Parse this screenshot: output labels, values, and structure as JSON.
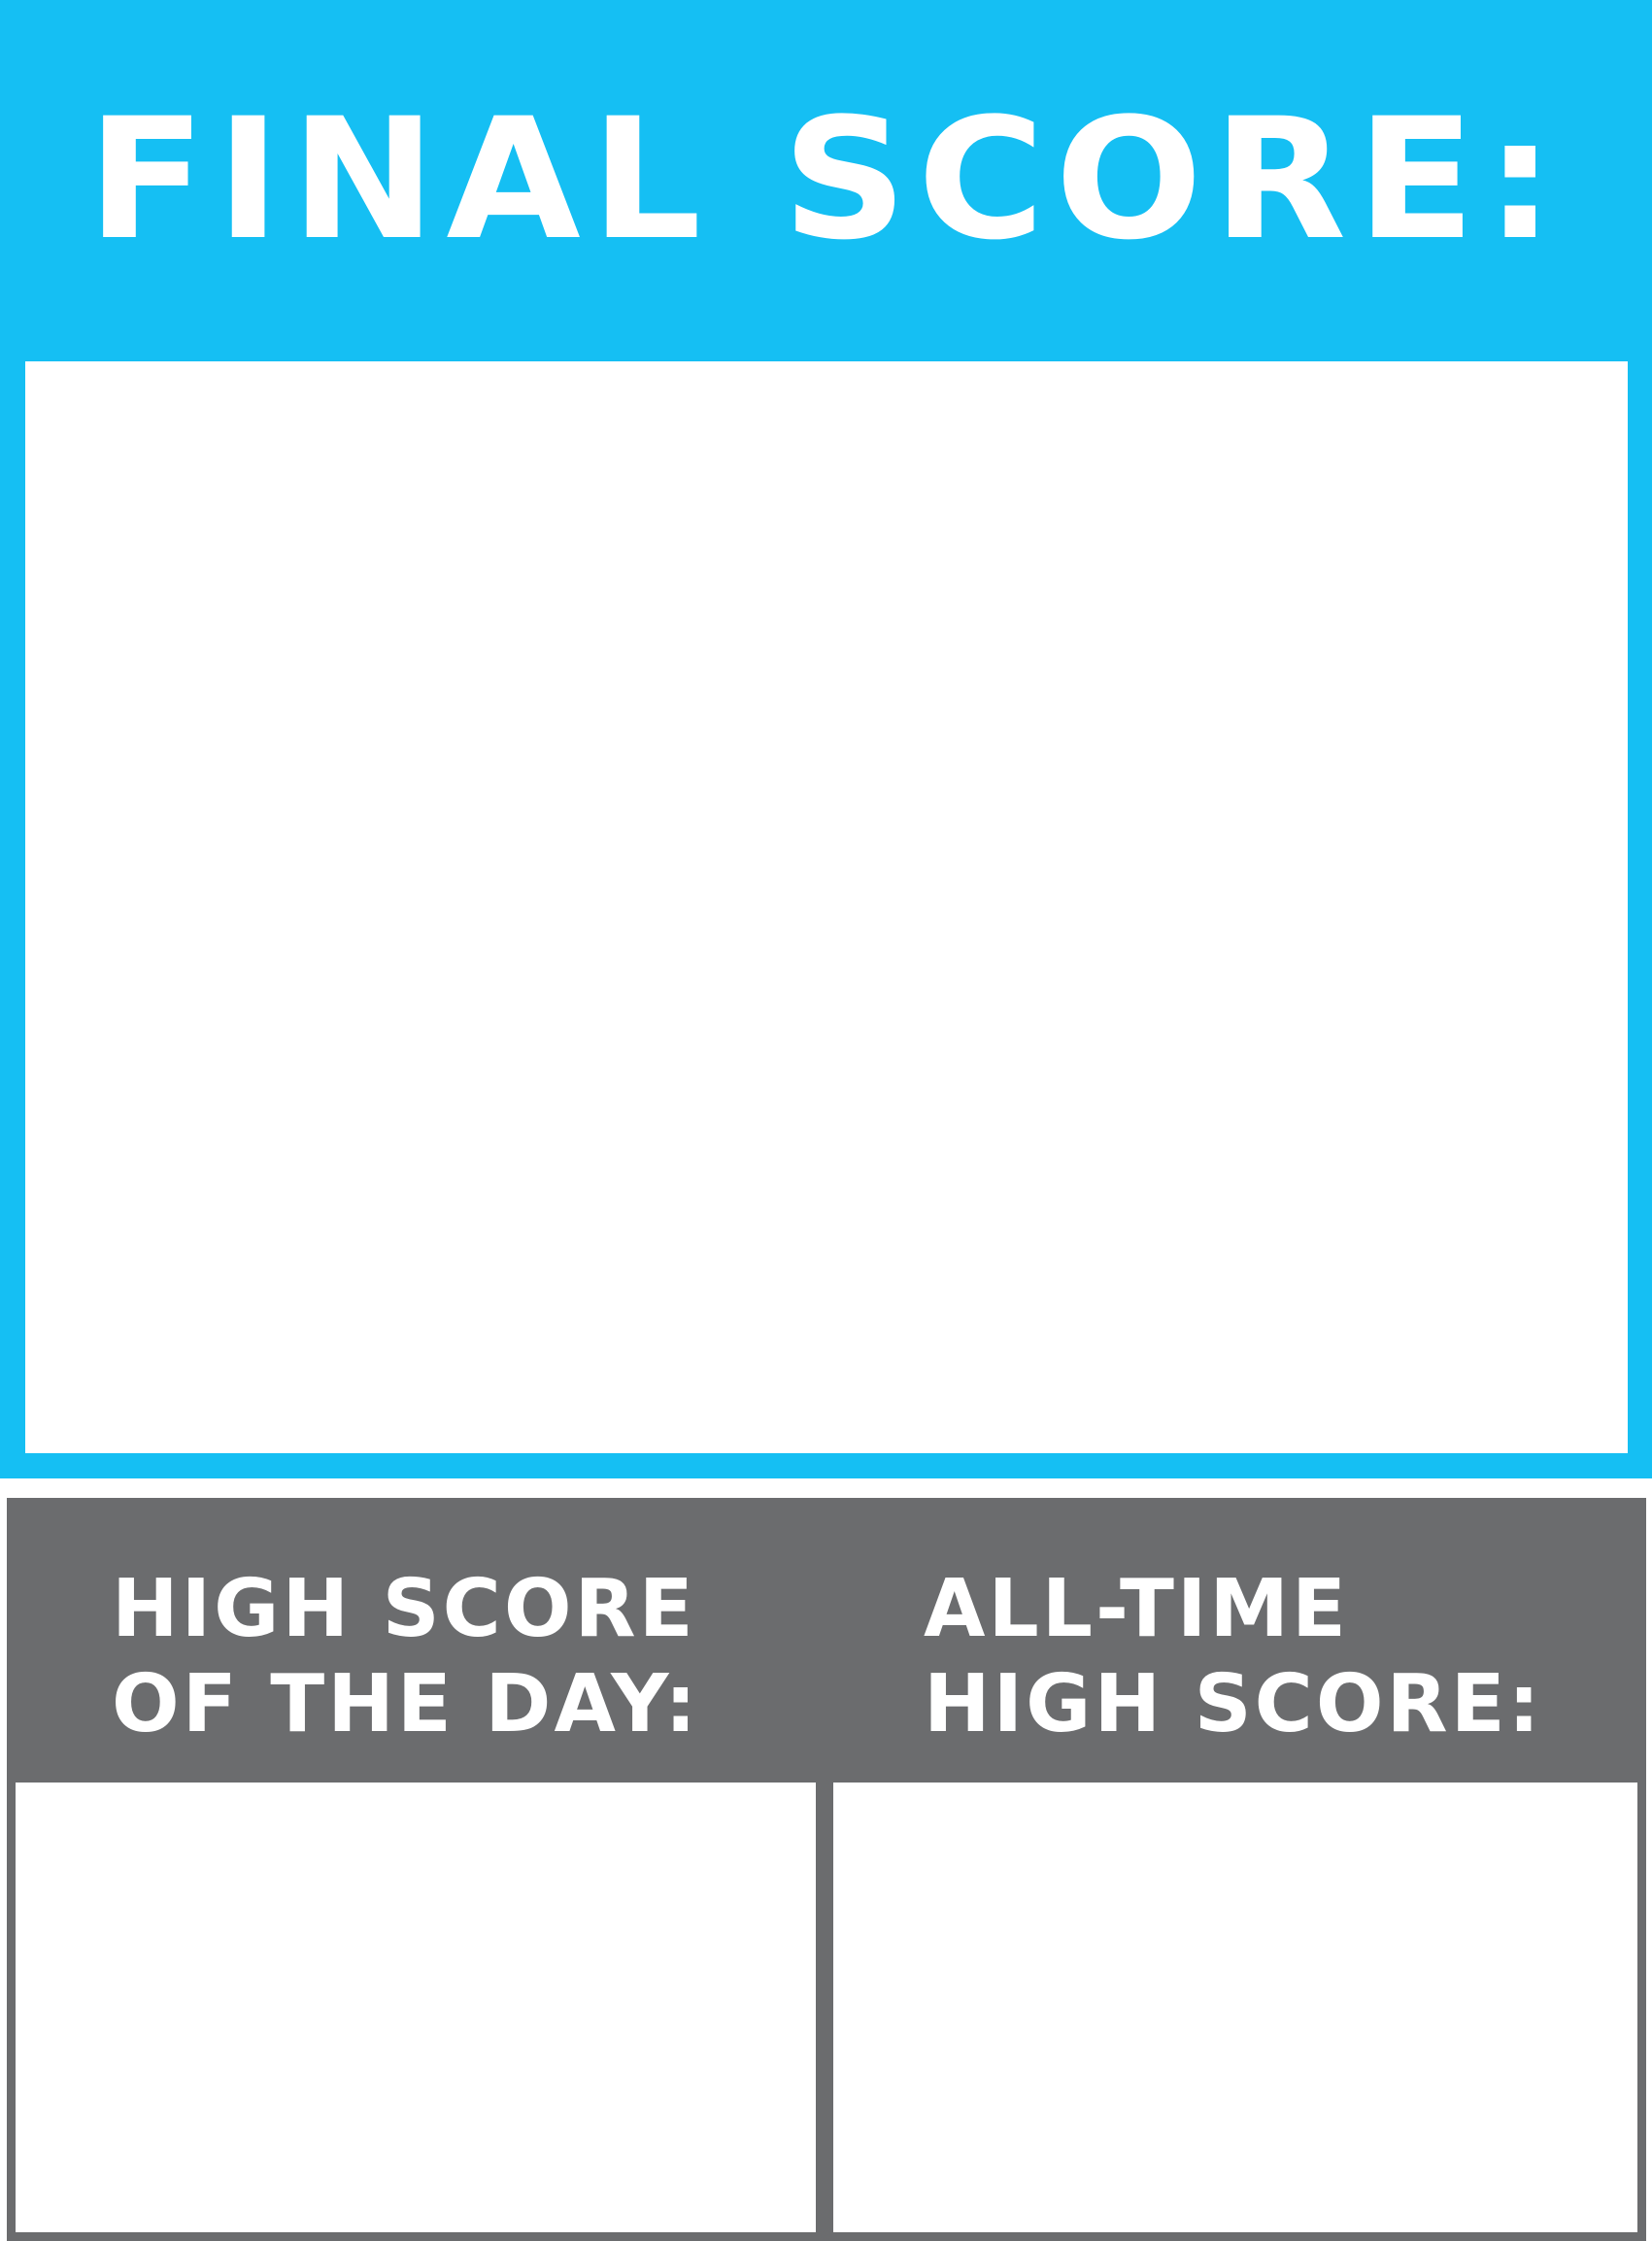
{
  "final_score": {
    "title": "FINAL SCORE:",
    "value": ""
  },
  "high_score_day": {
    "title_line1": "HIGH SCORE",
    "title_line2": "OF THE DAY:",
    "value": ""
  },
  "all_time_high": {
    "title_line1": "ALL-TIME",
    "title_line2": "HIGH SCORE:",
    "value": ""
  },
  "colors": {
    "final_panel": "#15bff3",
    "sub_panel": "#6b6c6e",
    "text": "#ffffff"
  }
}
